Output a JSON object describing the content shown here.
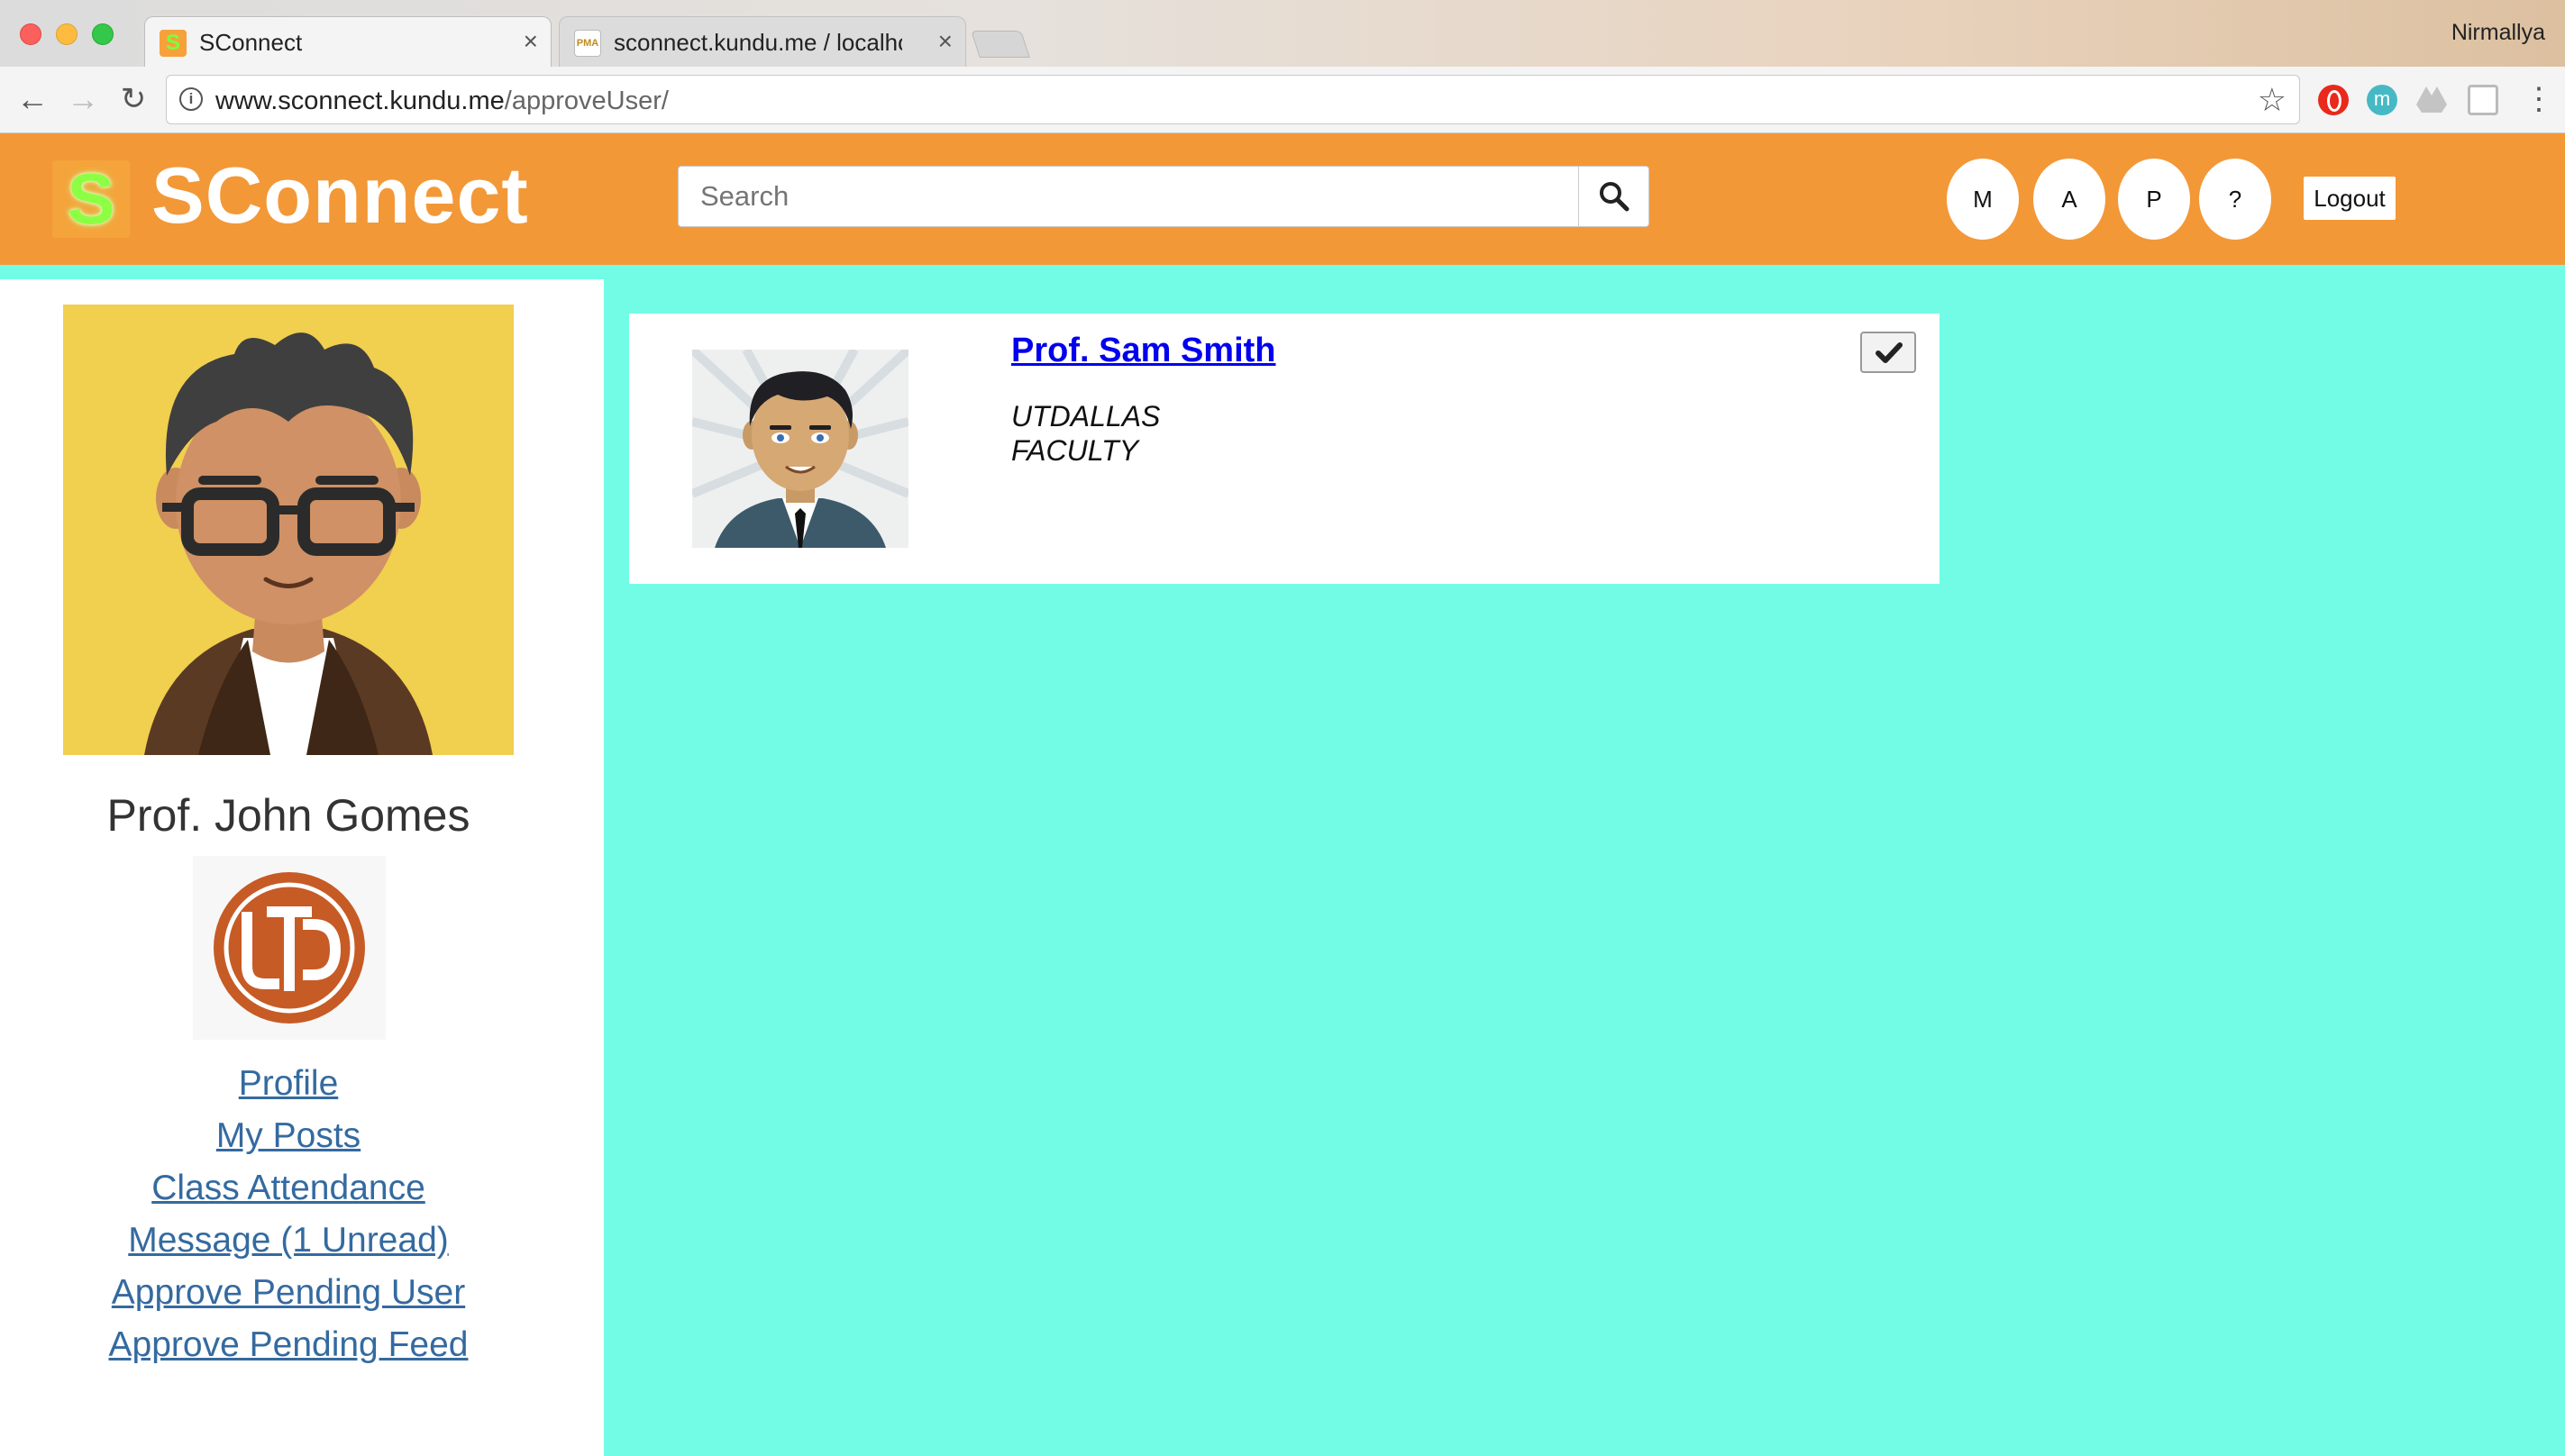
{
  "browser": {
    "tabs": [
      {
        "title": "SConnect",
        "favicon": "S",
        "active": true
      },
      {
        "title": "sconnect.kundu.me / localhost",
        "favicon": "PMA",
        "active": false
      }
    ],
    "profile_name": "Nirmallya",
    "address": {
      "host": "www.sconnect.kundu.me",
      "path": "/approveUser/"
    }
  },
  "header": {
    "logo_letter": "S",
    "brand": "SConnect",
    "search": {
      "placeholder": "Search",
      "value": ""
    },
    "quick_buttons": [
      "M",
      "A",
      "P",
      "?"
    ],
    "logout_label": "Logout",
    "accent_color": "#f39837"
  },
  "sidebar": {
    "user_name": "Prof. John Gomes",
    "links": [
      "Profile",
      "My Posts",
      "Class Attendance",
      "Message (1 Unread)",
      "Approve Pending User",
      "Approve Pending Feed"
    ]
  },
  "pending_users": [
    {
      "name": "Prof. Sam Smith",
      "organization": "UTDALLAS",
      "role": "FACULTY"
    }
  ],
  "colors": {
    "page_background": "#72fce6",
    "link": "#346aa0",
    "name_link": "#0000ee"
  }
}
